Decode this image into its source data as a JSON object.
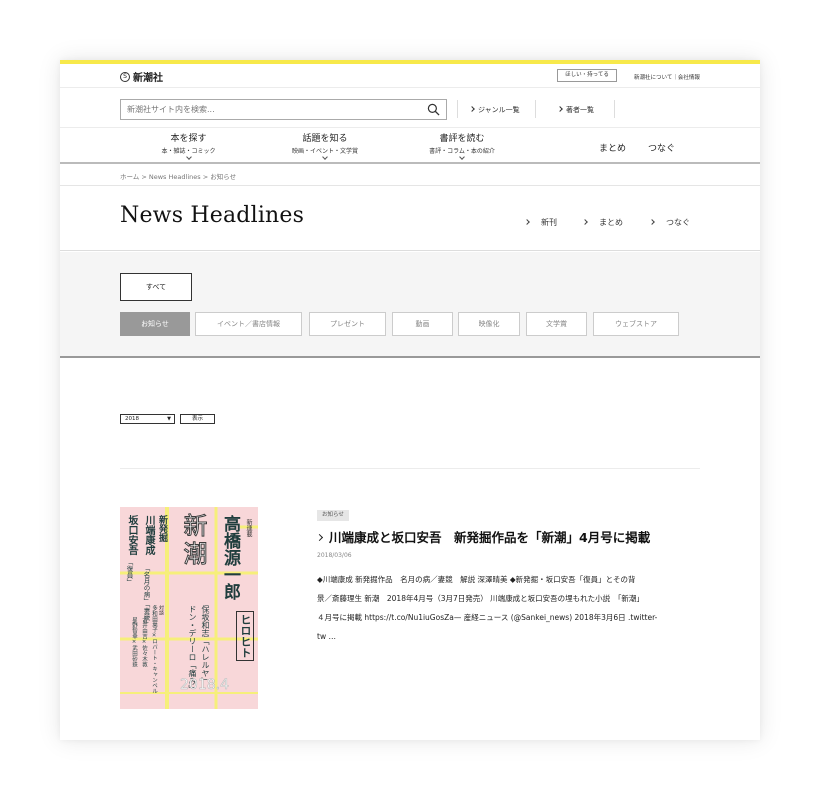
{
  "header": {
    "logo_text": "新潮社",
    "logo_mark": "S",
    "wish_button": "ほしい・持ってる",
    "util_links": "新潮社について｜会社情報",
    "search_placeholder": "新潮社サイト内を検索...",
    "genre_link": "ジャンル一覧",
    "author_link": "著者一覧"
  },
  "nav": [
    {
      "title": "本を探す",
      "sub": "本・雑誌・コミック"
    },
    {
      "title": "話題を知る",
      "sub": "映画・イベント・文学賞"
    },
    {
      "title": "書評を読む",
      "sub": "書評・コラム・本の紹介"
    }
  ],
  "nav_plain": [
    "まとめ",
    "つなぐ"
  ],
  "breadcrumb": "ホーム > News Headlines > お知らせ",
  "page": {
    "title": "News Headlines",
    "links": [
      "新刊",
      "まとめ",
      "つなぐ"
    ]
  },
  "filters": {
    "all_label": "すべて",
    "tabs": [
      "お知らせ",
      "イベント／書店情報",
      "プレゼント",
      "動画",
      "映像化",
      "文学賞",
      "ウェブストア"
    ],
    "active_index": 0
  },
  "archive": {
    "year_value": "2018",
    "show_label": "表示"
  },
  "article": {
    "category": "お知らせ",
    "headline": "川端康成と坂口安吾　新発掘作品を「新潮」4月号に掲載",
    "date": "2018/03/06",
    "summary_lines": [
      "◆川端康成 新発掘作品　名月の病／妻競　解説 深澤晴美 ◆新発掘・坂口安吾「復員」とその背",
      "景／斎藤理生 新潮　2018年4月号（3月7日発売） 川端康成と坂口安吾の埋もれた小説　「新潮」",
      "４月号に掲載 https://t.co/Nu1iuGosZa— 産経ニュース (@Sankei_news) 2018年3月6日 .twitter-",
      "tw …"
    ],
    "cover": {
      "kind_label": "新連載",
      "author_big": "高橋源一郎",
      "title_big": "ヒロヒト",
      "magazine": "新潮",
      "col1": "保坂和志「ハレルヤ」",
      "col2": "ドン・デリーロ「痛み」",
      "left_label": "新発掘",
      "left_author1": "川端康成",
      "left_works1": "「名月の病」「妻競」",
      "left_author2": "坂口安吾",
      "left_works2": "「復員」",
      "taidan": "対談",
      "taidan_names": "多和田葉子×ロバート・キャンベル",
      "extra_names": "古井由吉×佐々木敦",
      "extra_names2": "星野智幸×武田砂鉄",
      "issue": "2018.4"
    }
  },
  "colors": {
    "accent_yellow": "#f7e94b",
    "cover_pink": "#f8d7d9",
    "cover_yellow": "#f6ef7a",
    "active_tab": "#999999"
  }
}
